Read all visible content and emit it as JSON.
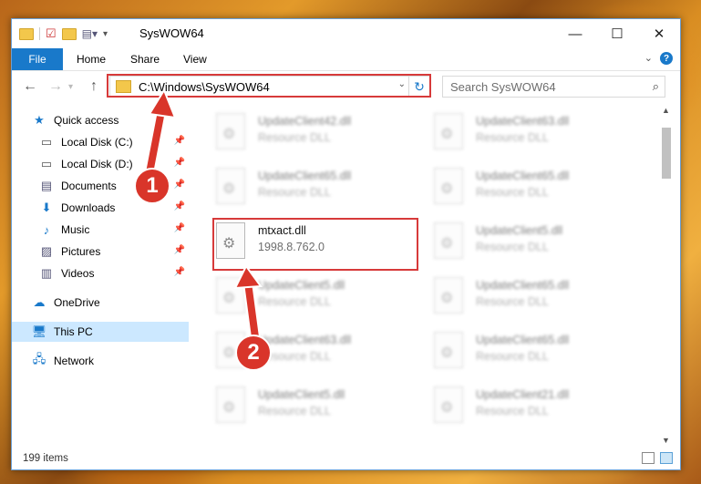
{
  "titlebar": {
    "title": "SysWOW64",
    "minimize": "—",
    "maximize": "☐",
    "close": "✕"
  },
  "ribbon": {
    "file": "File",
    "home": "Home",
    "share": "Share",
    "view": "View",
    "help": "?"
  },
  "navbar": {
    "back": "←",
    "forward": "→",
    "up": "↑",
    "address": "C:\\Windows\\SysWOW64",
    "refresh": "↻",
    "search_placeholder": "Search SysWOW64",
    "search_icon": "⌕"
  },
  "nav_pane": {
    "quick_access": "Quick access",
    "items": [
      {
        "label": "Local Disk (C:)",
        "icon": "drive-icon",
        "glyph": "▭"
      },
      {
        "label": "Local Disk (D:)",
        "icon": "drive-icon",
        "glyph": "▭"
      },
      {
        "label": "Documents",
        "icon": "documents-icon",
        "glyph": "▤"
      },
      {
        "label": "Downloads",
        "icon": "download-icon",
        "glyph": "⬇"
      },
      {
        "label": "Music",
        "icon": "music-icon",
        "glyph": "♪"
      },
      {
        "label": "Pictures",
        "icon": "pictures-icon",
        "glyph": "▨"
      },
      {
        "label": "Videos",
        "icon": "videos-icon",
        "glyph": "▥"
      }
    ],
    "onedrive": "OneDrive",
    "this_pc": "This PC",
    "network": "Network"
  },
  "files": [
    {
      "name": "UpdateClient42.dll",
      "type": "Resource DLL"
    },
    {
      "name": "UpdateClient63.dll",
      "type": "Resource DLL"
    },
    {
      "name": "UpdateClient65.dll",
      "type": "Resource DLL"
    },
    {
      "name": "UpdateClient65.dll",
      "type": "Resource DLL"
    },
    {
      "name": "mtxact.dll",
      "type": "1998.8.762.0"
    },
    {
      "name": "UpdateClient5.dll",
      "type": "Resource DLL"
    },
    {
      "name": "UpdateClient5.dll",
      "type": "Resource DLL"
    },
    {
      "name": "UpdateClient65.dll",
      "type": "Resource DLL"
    },
    {
      "name": "UpdateClient63.dll",
      "type": "Resource DLL"
    },
    {
      "name": "UpdateClient65.dll",
      "type": "Resource DLL"
    },
    {
      "name": "UpdateClient5.dll",
      "type": "Resource DLL"
    },
    {
      "name": "UpdateClient21.dll",
      "type": "Resource DLL"
    }
  ],
  "status": {
    "count": "199 items"
  },
  "markers": {
    "one": "1",
    "two": "2"
  },
  "colors": {
    "accent": "#1979ca",
    "highlight": "#d73a3a"
  }
}
